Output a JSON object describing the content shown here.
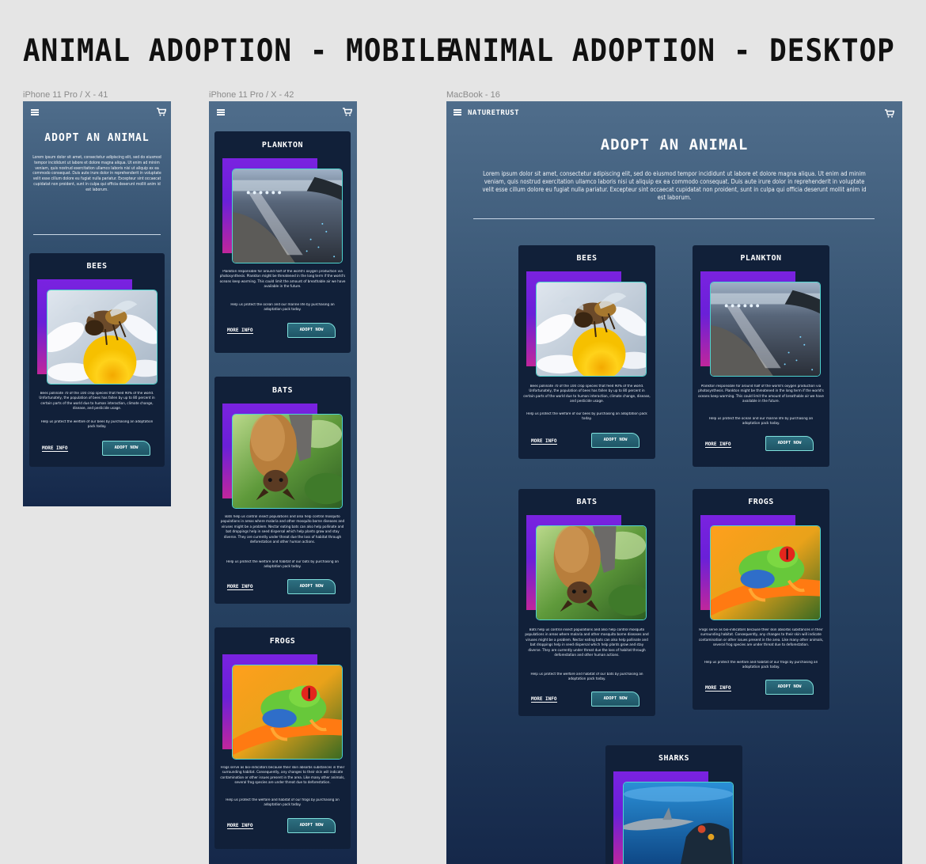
{
  "headings": {
    "mobile": "ANIMAL ADOPTION - MOBILE",
    "desktop": "ANIMAL ADOPTION - DESKTOP"
  },
  "frames": {
    "mobile1": "iPhone 11 Pro / X - 41",
    "mobile2": "iPhone 11 Pro / X - 42",
    "desktop": "MacBook - 16"
  },
  "brand": "NATURETRUST",
  "page": {
    "title": "ADOPT AN ANIMAL",
    "intro": "Lorem ipsum dolor sit amet, consectetur adipiscing elit, sed do eiusmod tempor incididunt ut labore et dolore magna aliqua. Ut enim ad minim veniam, quis nostrud exercitation ullamco laboris nisi ut aliquip ex ea commodo consequat. Duis aute irure dolor in reprehenderit in voluptate velit esse cillum dolore eu fugiat nulla pariatur. Excepteur sint occaecat cupidatat non proident, sunt in culpa qui officia deserunt mollit anim id est laborum."
  },
  "buttons": {
    "more_info": "MORE INFO",
    "adopt_now": "ADOPT NOW"
  },
  "animals": {
    "bees": {
      "name": "BEES",
      "desc": "Bees pollinate 70 of the 100 crop species that feed 90% of the world. Unfortunately, the population of bees has fallen by up to 80 percent in certain parts of the world due to human interaction, climate change, disease, and pesticide usage.",
      "cta": "Help us protect the welfare of our bees by purchasing an adoptation pack today."
    },
    "plankton": {
      "name": "PLANKTON",
      "desc": "Plankton responsible for around half of the world's oxygen production via photosynthesis. Plankton might be threatened in the long term if the world's oceans keep warming. This could limit the amount of breathable air we have available in the future.",
      "cta": "Help us protect the ocean and our marine life by purchasing an adoptation pack today."
    },
    "bats": {
      "name": "BATS",
      "desc": "Bats help us control insect populations and also help control mosquito populations in areas where malaria and other mosquito borne diseases and viruses might be a problem. Nectar eating bats can also help pollinate and bat droppings help in seed dispersal which help plants grow and stay diverse. They are currently under threat due the loss of habitat through deforestation and other human actions.",
      "cta": "Help us protect the welfare and habitat of our bats by purchasing an adoptation pack today."
    },
    "frogs": {
      "name": "FROGS",
      "desc": "Frogs serve as bio-indicators because their skin absorbs substances in their surrounding habitat. Consequently, any changes to their skin will indicate contamination or other issues present in the area. Like many other animals, several frog species are under threat due to deforestation.",
      "cta": "Help us protect the welfare and habitat of our frogs by purchasing an adoptation pack today."
    },
    "sharks": {
      "name": "SHARKS"
    }
  },
  "colors": {
    "card_bg": "#112039",
    "accent_teal": "#4fd4cf",
    "deco_purple": "#6a20d8",
    "deco_pink": "#c0269c"
  }
}
